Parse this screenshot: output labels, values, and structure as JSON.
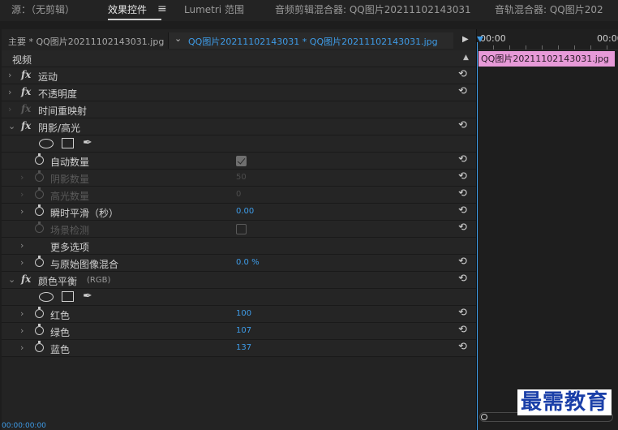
{
  "tabs": [
    {
      "label": "源：（无剪辑）",
      "active": false
    },
    {
      "label": "效果控件",
      "active": true
    },
    {
      "label": "Lumetri 范围",
      "active": false
    },
    {
      "label": "音频剪辑混合器: QQ图片20211102143031",
      "active": false
    },
    {
      "label": "音轨混合器: QQ图片202",
      "active": false
    }
  ],
  "tab_menu_icon": "hamburger-icon",
  "sequence": {
    "master_label": "主要 * QQ图片20211102143031.jpg",
    "clip_label": "QQ图片20211102143031  * QQ图片20211102143031.jpg"
  },
  "effects": {
    "header": "视频",
    "motion": "运动",
    "opacity": "不透明度",
    "time_remap": "时间重映射",
    "shadow_highlight": {
      "title": "阴影/高光",
      "auto_amount": {
        "label": "自动数量",
        "checked": true
      },
      "shadow_amount": {
        "label": "阴影数量",
        "value": "50"
      },
      "highlight_amount": {
        "label": "高光数量",
        "value": "0"
      },
      "temporal_smoothing": {
        "label": "瞬时平滑（秒）",
        "value": "0.00"
      },
      "scene_detect": {
        "label": "场景检测",
        "checked": false
      },
      "more_options": "更多选项",
      "blend": {
        "label": "与原始图像混合",
        "value": "0.0 %"
      }
    },
    "color_balance": {
      "title": "颜色平衡",
      "suffix": "(RGB)",
      "red": {
        "label": "红色",
        "value": "100"
      },
      "green": {
        "label": "绿色",
        "value": "107"
      },
      "blue": {
        "label": "蓝色",
        "value": "137"
      }
    }
  },
  "timeline": {
    "timecode_start": "00:00",
    "timecode_end": "00:00",
    "clip_label": "QQ图片20211102143031.jpg",
    "clip_color": "#e79ad8",
    "footer_timecode": "00:00:00:00"
  },
  "watermark": "最需教育",
  "colors": {
    "accent": "#3e9ce8",
    "panel": "#232323"
  }
}
